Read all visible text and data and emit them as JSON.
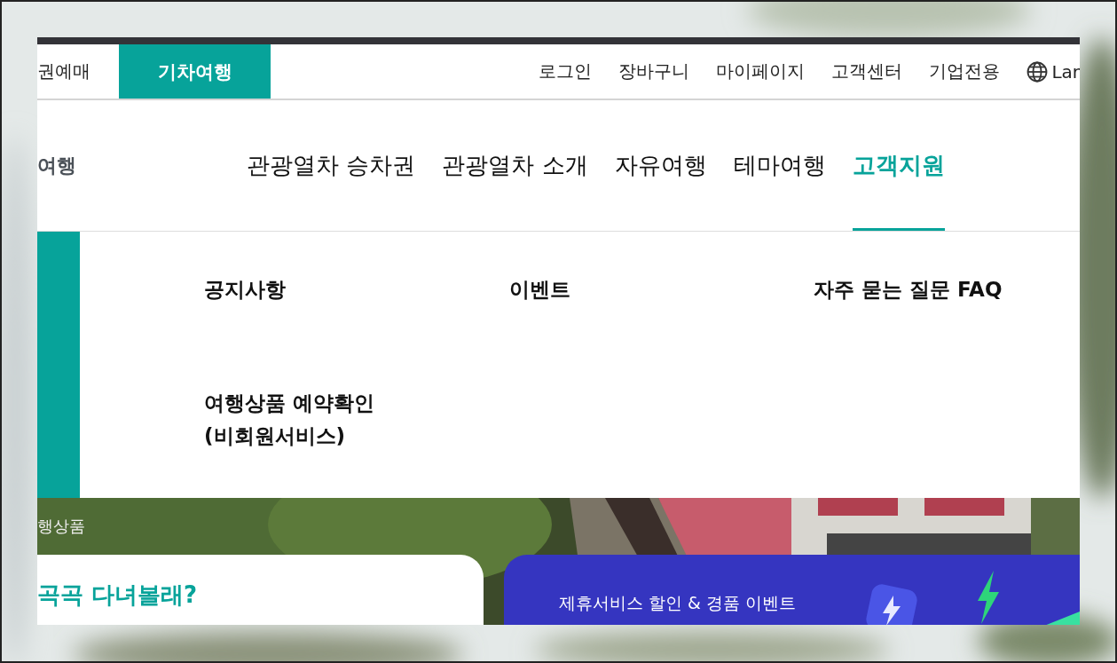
{
  "top_bar": {
    "tabs": [
      {
        "label": "권예매",
        "selected": false
      },
      {
        "label": "기차여행",
        "selected": true
      }
    ],
    "links": [
      "로그인",
      "장바구니",
      "마이페이지",
      "고객센터",
      "기업전용"
    ],
    "language": "Lar"
  },
  "main_nav": {
    "side_label": "여행",
    "items": [
      {
        "label": "관광열차 승차권",
        "selected": false
      },
      {
        "label": "관광열차 소개",
        "selected": false
      },
      {
        "label": "자유여행",
        "selected": false
      },
      {
        "label": "테마여행",
        "selected": false
      },
      {
        "label": "고객지원",
        "selected": true
      }
    ]
  },
  "dropdown": {
    "items": [
      "공지사항",
      "이벤트",
      "자주 묻는 질문 FAQ",
      "여행상품 예약확인\n(비회원서비스)"
    ]
  },
  "hero": {
    "kind": "picture",
    "caption": "행상품"
  },
  "cards": [
    {
      "kind": "plain",
      "title": "곡곡 다녀볼래?"
    },
    {
      "kind": "promo",
      "title": "제휴서비스 할인 & 경품 이벤트"
    }
  ]
}
